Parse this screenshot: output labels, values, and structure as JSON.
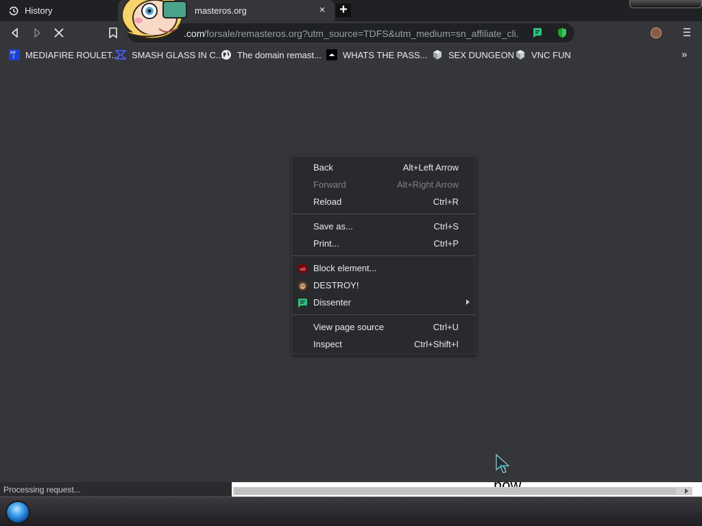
{
  "tabs": {
    "history_label": "History",
    "active_title": "masteros.org",
    "close_glyph": "×",
    "new_tab_glyph": "+"
  },
  "omnibox": {
    "host_fragment": ".com",
    "path": "/forsale/remasteros.org?utm_source=TDFS&utm_medium=sn_affiliate_cli..."
  },
  "bookmarks": [
    {
      "label": "MEDIAFIRE ROULET...",
      "icon": "mediafire-icon"
    },
    {
      "label": "SMASH GLASS IN C...",
      "icon": "smash-glass-icon"
    },
    {
      "label": "The domain remast...",
      "icon": "globe-icon"
    },
    {
      "label": "WHATS THE PASS...",
      "icon": "pass-icon"
    },
    {
      "label": "SEX DUNGEON",
      "icon": "dungeon-icon"
    },
    {
      "label": "VNC FUN",
      "icon": "vnc-icon"
    }
  ],
  "bookmarks_more_glyph": "»",
  "context_menu": {
    "items": [
      {
        "label": "Back",
        "accel": "Alt+Left Arrow",
        "enabled": true
      },
      {
        "label": "Forward",
        "accel": "Alt+Right Arrow",
        "enabled": false
      },
      {
        "label": "Reload",
        "accel": "Ctrl+R",
        "enabled": true
      },
      {
        "label": "Save as...",
        "accel": "Ctrl+S",
        "enabled": true
      },
      {
        "label": "Print...",
        "accel": "Ctrl+P",
        "enabled": true
      },
      {
        "label": "Block element...",
        "accel": "",
        "enabled": true,
        "icon": "ublock-icon"
      },
      {
        "label": "DESTROY!",
        "accel": "",
        "enabled": true,
        "icon": "destroy-avatar-icon"
      },
      {
        "label": "Dissenter",
        "accel": "",
        "enabled": true,
        "icon": "dissenter-icon",
        "submenu": true
      },
      {
        "label": "View page source",
        "accel": "Ctrl+U",
        "enabled": true
      },
      {
        "label": "Inspect",
        "accel": "Ctrl+Shift+I",
        "enabled": true
      }
    ]
  },
  "status_text": "Processing request...",
  "page_fragment_text": "now",
  "colors": {
    "page_bg": "#35363a",
    "menu_bg": "#292a2d",
    "accent_green": "#2ec27e",
    "ublock_red": "#800000"
  }
}
